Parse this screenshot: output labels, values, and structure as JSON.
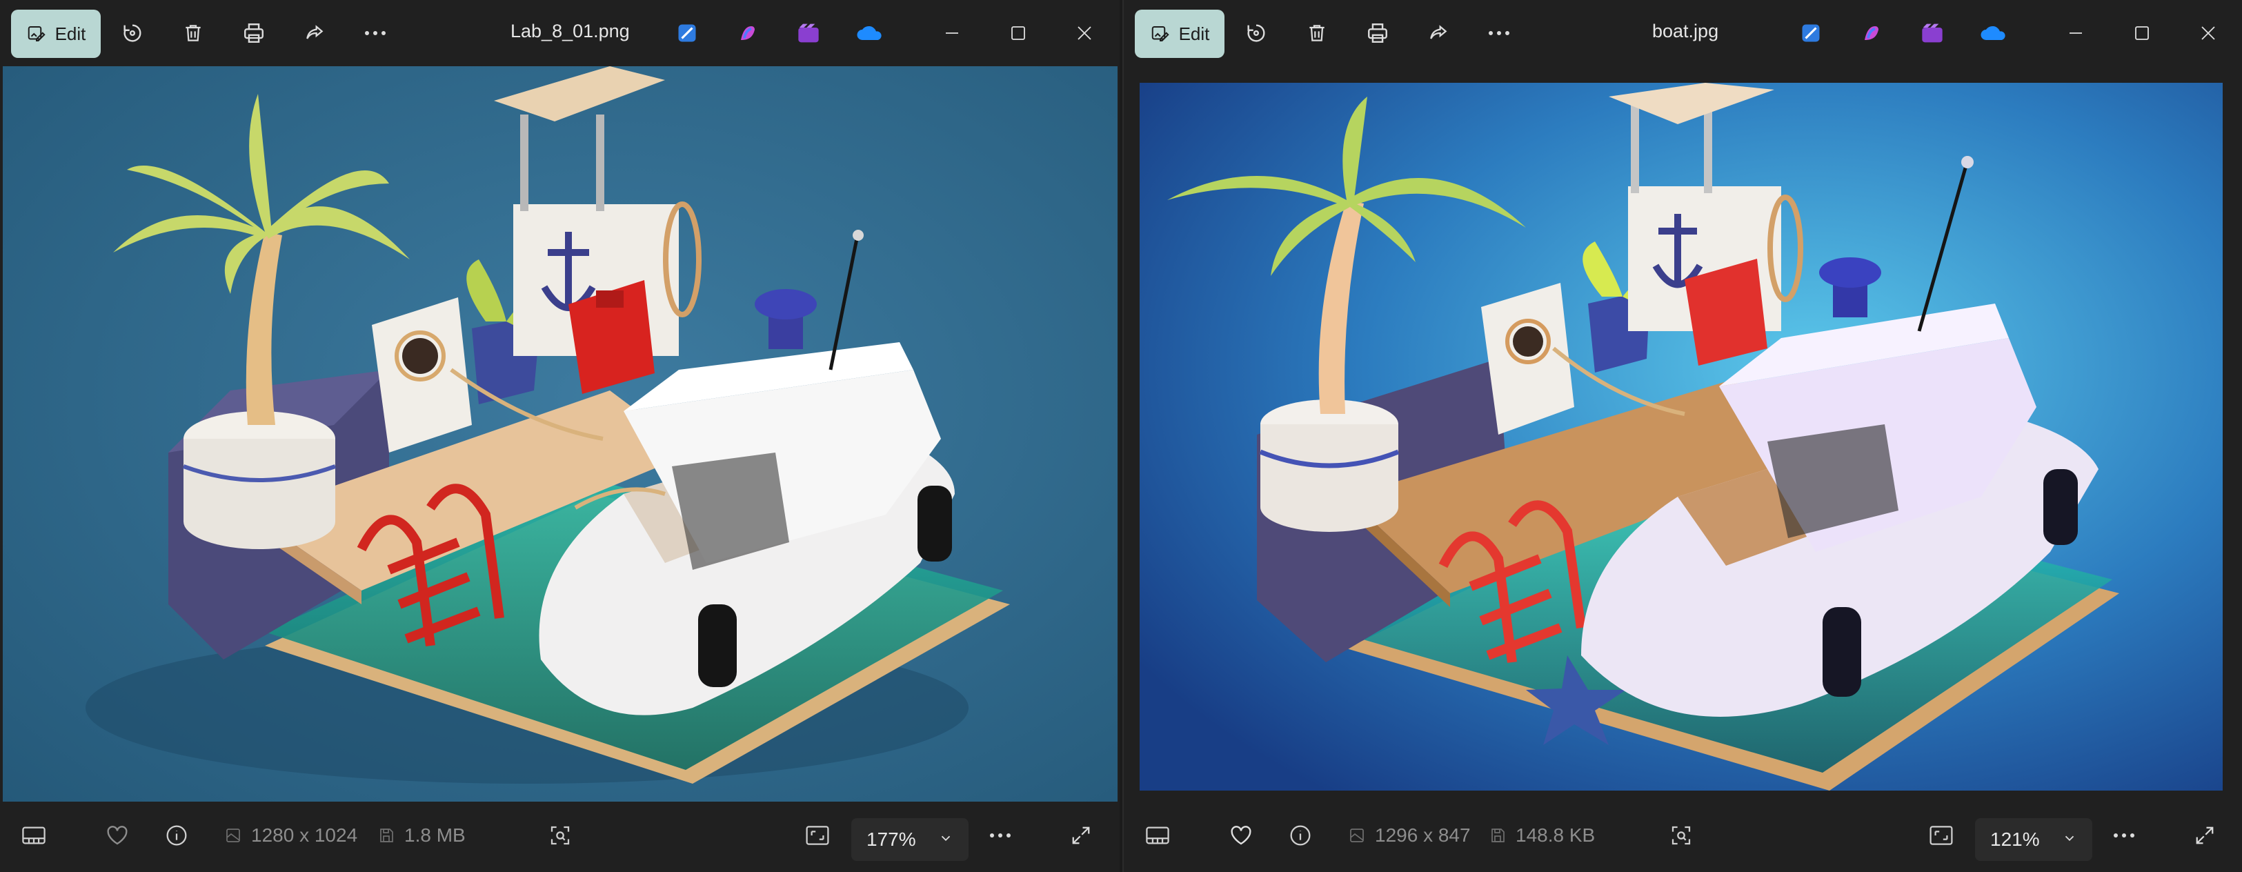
{
  "windows": [
    {
      "id": "left",
      "toolbar": {
        "edit_label": "Edit",
        "filename": "Lab_8_01.png"
      },
      "status": {
        "dimensions": "1280 x 1024",
        "file_size": "1.8 MB",
        "zoom": "177%"
      }
    },
    {
      "id": "right",
      "toolbar": {
        "edit_label": "Edit",
        "filename": "boat.jpg"
      },
      "status": {
        "dimensions": "1296 x 847",
        "file_size": "148.8 KB",
        "zoom": "121%"
      }
    }
  ],
  "icons": {
    "toolbar": [
      "rotate-icon",
      "delete-icon",
      "print-icon",
      "share-icon",
      "more-icon"
    ],
    "apps": [
      "designer-icon",
      "copilot-icon",
      "clipchamp-icon",
      "onedrive-icon"
    ],
    "window_controls": [
      "minimize-icon",
      "maximize-icon",
      "close-icon"
    ],
    "status": [
      "filmstrip-icon",
      "favorite-icon",
      "info-icon",
      "image-size-icon",
      "save-icon",
      "visual-search-icon",
      "fit-screen-icon",
      "more-icon",
      "fullscreen-icon"
    ]
  },
  "colors": {
    "edit_button_bg": "#b9d7d3",
    "left_photo_bg": "#2f6a8e",
    "right_photo_bg": "#2d6ea8"
  }
}
